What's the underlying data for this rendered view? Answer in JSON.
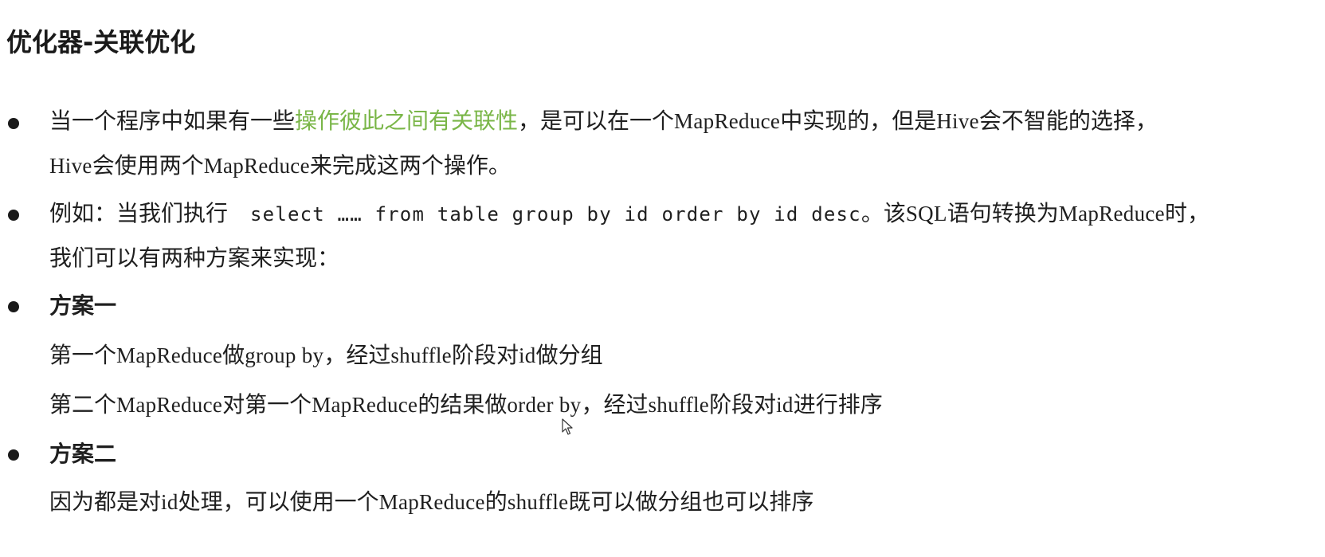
{
  "title": "优化器-关联优化",
  "b1": {
    "l1_p1": "当一个程序中如果有一些",
    "l1_highlight": "操作彼此之间有关联性",
    "l1_p2": "，是可以在一个",
    "l1_mr": "MapReduce",
    "l1_p3": "中实现的，但是",
    "l1_hive": "Hive",
    "l1_p4": "会不智能的选择，",
    "l2_hive": "Hive",
    "l2_p1": "会使用两个",
    "l2_mr": "MapReduce",
    "l2_p2": "来完成这两个操作。"
  },
  "b2": {
    "l1_p1": "例如：当我们执行",
    "l1_code": "select …… from table group by id order by id desc",
    "l1_p2": "。该",
    "l1_sql": "SQL",
    "l1_p3": "语句转换为",
    "l1_mr": "MapReduce",
    "l1_p4": "时，",
    "l2": "我们可以有两种方案来实现："
  },
  "b3": {
    "heading": "方案一",
    "l1_p1": "第一个",
    "l1_mr": "MapReduce",
    "l1_p2": "做",
    "l1_gb": "group by",
    "l1_p3": "，经过",
    "l1_sh": "shuffle",
    "l1_p4": "阶段对",
    "l1_id": "id",
    "l1_p5": "做分组",
    "l2_p1": "第二个",
    "l2_mr1": "MapReduce",
    "l2_p2": "对第一个",
    "l2_mr2": "MapReduce",
    "l2_p3": "的结果做",
    "l2_ob": "order by",
    "l2_p4": "，经过",
    "l2_sh": "shuffle",
    "l2_p5": "阶段对",
    "l2_id": "id",
    "l2_p6": "进行排序"
  },
  "b4": {
    "heading": "方案二",
    "l1_p1": "因为都是对",
    "l1_id": "id",
    "l1_p2": "处理，可以使用一个",
    "l1_mr": "MapReduce",
    "l1_p3": "的",
    "l1_sh": "shuffle",
    "l1_p4": "既可以做分组也可以排序"
  },
  "colors": {
    "highlight": "#7ab648",
    "text": "#1f1f1f"
  },
  "icons": {
    "bullet": "filled-circle",
    "cursor": "mouse-pointer-icon"
  }
}
